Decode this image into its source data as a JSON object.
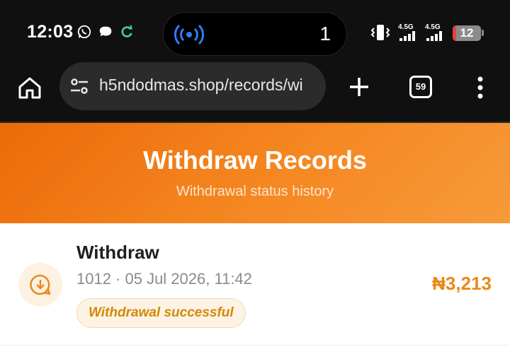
{
  "status_bar": {
    "time": "12:03",
    "island_count": "1",
    "network_1": "4.5G",
    "network_2": "4.5G",
    "battery": "12",
    "colors": {
      "accent_hotspot": "#2f7cf6",
      "sync_icon": "#3ecf8e",
      "battery_low": "#e0453f"
    }
  },
  "browser": {
    "url": "h5ndodmas.shop/records/wi",
    "tab_count": "59"
  },
  "header": {
    "title": "Withdraw Records",
    "subtitle": "Withdrawal status history"
  },
  "records": [
    {
      "title": "Withdraw",
      "meta": "1012 · 05 Jul 2026, 11:42",
      "status": "Withdrawal successful",
      "amount": "₦3,213",
      "icon": "download-circle-icon"
    }
  ],
  "colors": {
    "brand_orange": "#f07a14",
    "amount": "#e9891a",
    "badge_text": "#d48806"
  }
}
